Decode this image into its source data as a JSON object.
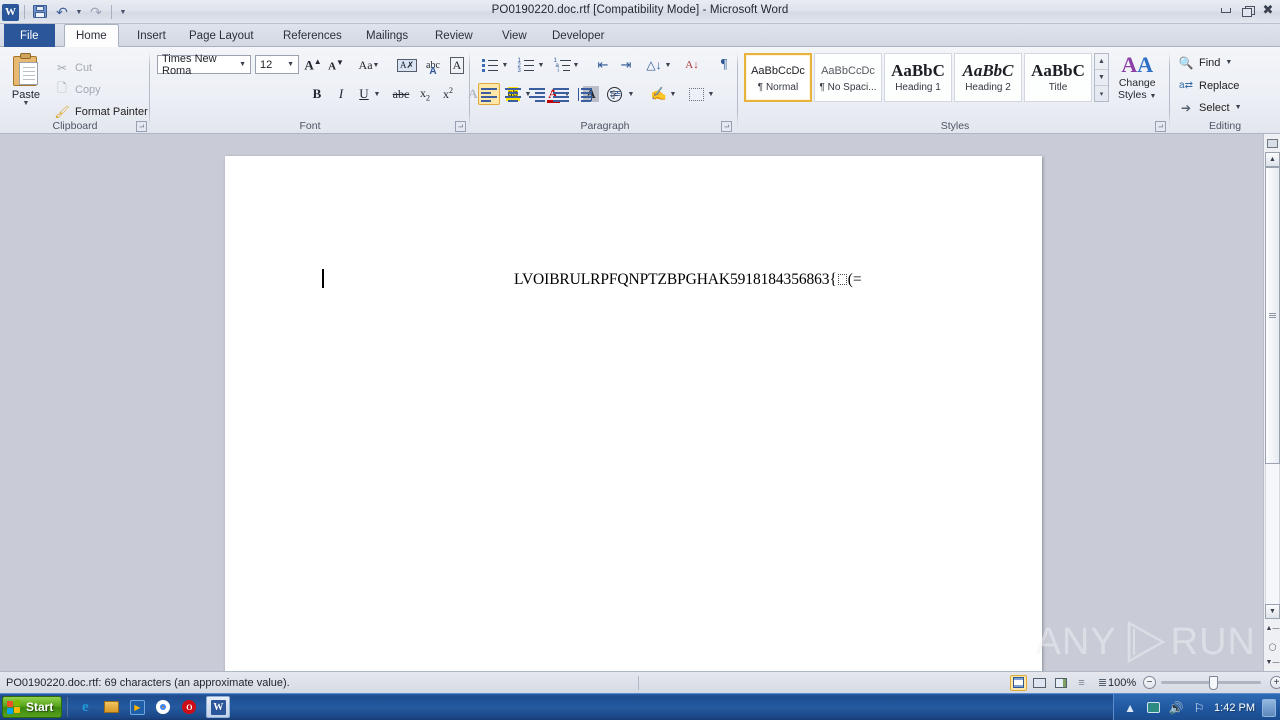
{
  "window": {
    "title": "PO0190220.doc.rtf [Compatibility Mode]  -  Microsoft Word",
    "app_icon": "word-icon",
    "controls": {
      "minimize": "minimize-icon",
      "restore": "restore-icon",
      "close": "close-icon"
    }
  },
  "quick_access": {
    "save": "save-icon",
    "undo": "undo-icon",
    "undo_caret": "chevron-down-icon",
    "redo": "redo-icon",
    "customize": "customize-qat-icon"
  },
  "ribbon": {
    "tabs": [
      {
        "label": "File",
        "active": false,
        "is_file": true
      },
      {
        "label": "Home",
        "active": true
      },
      {
        "label": "Insert",
        "active": false
      },
      {
        "label": "Page Layout",
        "active": false
      },
      {
        "label": "References",
        "active": false
      },
      {
        "label": "Mailings",
        "active": false
      },
      {
        "label": "Review",
        "active": false
      },
      {
        "label": "View",
        "active": false
      },
      {
        "label": "Developer",
        "active": false
      }
    ],
    "groups": {
      "clipboard": {
        "label": "Clipboard",
        "paste": "Paste",
        "items": [
          {
            "label": "Cut",
            "icon": "scissors-icon"
          },
          {
            "label": "Copy",
            "icon": "copy-icon"
          },
          {
            "label": "Format Painter",
            "icon": "paintbrush-icon"
          }
        ]
      },
      "font": {
        "label": "Font",
        "font_name": "Times New Roma",
        "font_size": "12",
        "buttons": [
          "grow-font-icon",
          "shrink-font-icon",
          "change-case-icon",
          "clear-formatting-icon",
          "phonetic-guide-icon",
          "character-border-icon",
          "bold-icon",
          "italic-icon",
          "underline-icon",
          "strikethrough-icon",
          "subscript-icon",
          "superscript-icon",
          "text-effects-icon",
          "highlight-color-icon",
          "font-color-icon",
          "character-shading-icon",
          "enclose-characters-icon"
        ]
      },
      "paragraph": {
        "label": "Paragraph",
        "buttons": [
          "bullets-icon",
          "numbering-icon",
          "multilevel-list-icon",
          "decrease-indent-icon",
          "increase-indent-icon",
          "sort-icon",
          "show-formatting-marks-icon",
          "align-left-icon",
          "align-center-icon",
          "align-right-icon",
          "justify-icon",
          "distributed-icon",
          "line-spacing-icon",
          "shading-icon",
          "borders-icon"
        ],
        "active": "align-left-icon"
      },
      "styles": {
        "label": "Styles",
        "items": [
          {
            "preview": "AaBbCcDc",
            "name": "¶ Normal",
            "selected": true
          },
          {
            "preview": "AaBbCcDc",
            "name": "¶ No Spaci...",
            "selected": false
          },
          {
            "preview": "AaBbC",
            "name": "Heading 1",
            "selected": false
          },
          {
            "preview": "AaBbC",
            "name": "Heading 2",
            "selected": false
          },
          {
            "preview": "AaBbC",
            "name": "Title",
            "selected": false
          }
        ],
        "change_styles_line1": "Change",
        "change_styles_line2": "Styles"
      },
      "editing": {
        "label": "Editing",
        "items": [
          {
            "label": "Find",
            "icon": "binoculars-icon",
            "caret": true
          },
          {
            "label": "Replace",
            "icon": "replace-icon",
            "caret": false
          },
          {
            "label": "Select",
            "icon": "cursor-select-icon",
            "caret": true
          }
        ]
      }
    }
  },
  "document": {
    "text": "LVOIBRULRPFQNPTZBPGHAK5918184356863{",
    "text_tail": "(=",
    "control_char": "control-character-box"
  },
  "watermark": {
    "left": "ANY",
    "right": "RUN",
    "logo": "anyrun-play-logo"
  },
  "status_bar": {
    "message": "PO0190220.doc.rtf: 69 characters (an approximate value).",
    "view_buttons": [
      "print-layout-icon",
      "full-screen-reading-icon",
      "web-layout-icon",
      "outline-icon",
      "draft-icon"
    ],
    "active_view": "print-layout-icon",
    "zoom": "100%",
    "zoom_out": "zoom-out-icon",
    "zoom_in": "zoom-in-icon"
  },
  "taskbar": {
    "start": "Start",
    "quick_launch": [
      {
        "name": "internet-explorer-icon"
      },
      {
        "name": "folder-icon"
      },
      {
        "name": "media-player-icon"
      },
      {
        "name": "chrome-icon"
      },
      {
        "name": "opera-icon"
      }
    ],
    "running": [
      {
        "name": "word-taskbar-icon"
      }
    ],
    "tray": [
      {
        "name": "show-hidden-icons-chevron"
      },
      {
        "name": "network-icon"
      },
      {
        "name": "volume-icon"
      },
      {
        "name": "flag-action-center-icon"
      }
    ],
    "time": "1:42 PM",
    "show_desktop": "show-desktop-icon"
  },
  "colors": {
    "accent": "#2b579a",
    "selection": "#ffe7a8",
    "selection_border": "#e0a93a",
    "page": "#ffffff",
    "canvas": "#c9ccd6"
  }
}
